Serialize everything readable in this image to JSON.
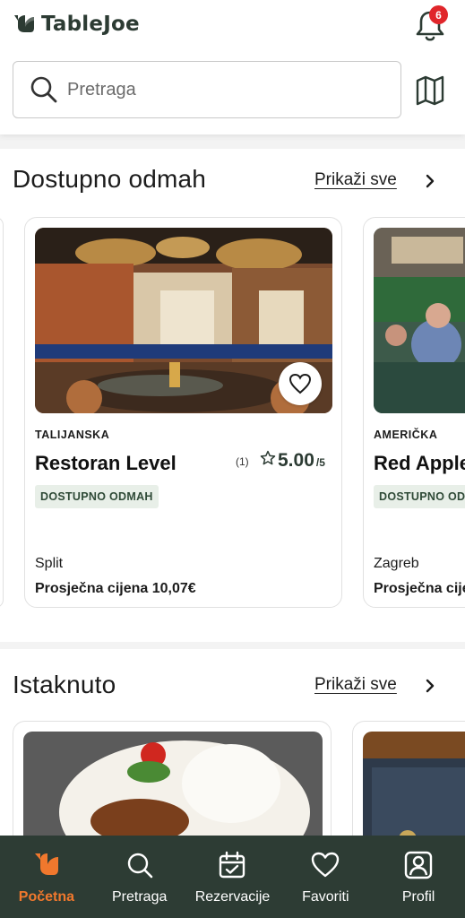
{
  "header": {
    "app_name": "TableJoe",
    "notification_count": "6",
    "search_placeholder": "Pretraga"
  },
  "colors": {
    "brand_dark": "#2d3c34",
    "accent": "#f0782d",
    "badge_red": "#e0262b",
    "badge_green_bg": "#e8efe8"
  },
  "icons": {
    "logo": "tablejoe-leaf-logo",
    "notifications": "bell-icon",
    "search": "search-icon",
    "map": "map-icon",
    "favorite": "heart-icon",
    "rating": "star-icon",
    "chevron": "chevron-right-icon"
  },
  "available_now": {
    "title": "Dostupno odmah",
    "show_all": "Prikaži sve",
    "cards": [
      {
        "cuisine": "TALIJANSKA",
        "name": "Restoran Level",
        "reviews": "(1)",
        "rating": "5.00",
        "rating_max": "/5",
        "badge": "DOSTUPNO ODMAH",
        "city": "Split",
        "price": "Prosječna cijena 10,07€"
      },
      {
        "cuisine": "AMERIČKA",
        "name": "Red Apple",
        "badge": "DOSTUPNO ODMAH",
        "city": "Zagreb",
        "price": "Prosječna cijena"
      }
    ]
  },
  "featured": {
    "title": "Istaknuto",
    "show_all": "Prikaži sve"
  },
  "bottom_nav": {
    "items": [
      {
        "label": "Početna",
        "icon": "home-icon",
        "active": true
      },
      {
        "label": "Pretraga",
        "icon": "search-icon",
        "active": false
      },
      {
        "label": "Rezervacije",
        "icon": "calendar-check-icon",
        "active": false
      },
      {
        "label": "Favoriti",
        "icon": "heart-icon",
        "active": false
      },
      {
        "label": "Profil",
        "icon": "profile-icon",
        "active": false
      }
    ]
  }
}
